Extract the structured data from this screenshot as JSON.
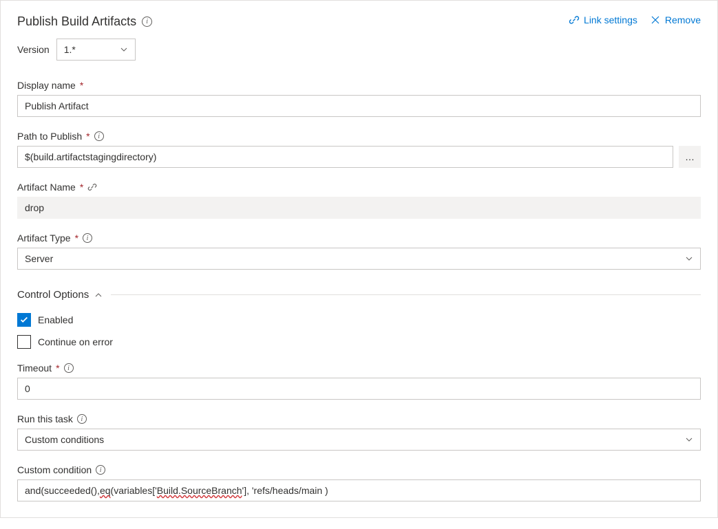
{
  "header": {
    "title": "Publish Build Artifacts",
    "link_settings": "Link settings",
    "remove": "Remove"
  },
  "version": {
    "label": "Version",
    "selected": "1.*"
  },
  "fields": {
    "display_name": {
      "label": "Display name",
      "value": "Publish Artifact"
    },
    "path_to_publish": {
      "label": "Path to Publish",
      "value": "$(build.artifactstagingdirectory)",
      "browse": "…"
    },
    "artifact_name": {
      "label": "Artifact Name",
      "value": "drop"
    },
    "artifact_type": {
      "label": "Artifact Type",
      "selected": "Server"
    }
  },
  "control_options": {
    "section_title": "Control Options",
    "enabled": {
      "label": "Enabled",
      "checked": true
    },
    "continue_on_error": {
      "label": "Continue on error",
      "checked": false
    },
    "timeout": {
      "label": "Timeout",
      "value": "0"
    },
    "run_this_task": {
      "label": "Run this task",
      "selected": "Custom conditions"
    },
    "custom_condition": {
      "label": "Custom condition",
      "prefix": "and(succeeded(), ",
      "squiggle1": "eq",
      "mid": "(variables['",
      "squiggle2": "Build.SourceBranch",
      "suffix": "'], 'refs/heads/main )"
    }
  }
}
